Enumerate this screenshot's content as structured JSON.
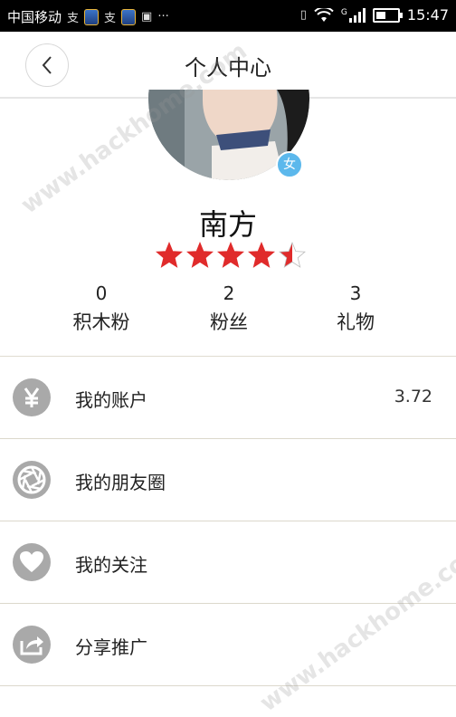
{
  "status_bar": {
    "carrier": "中国移动",
    "signal_label": "G",
    "time": "15:47",
    "battery_level": 0.45
  },
  "header": {
    "title": "个人中心"
  },
  "profile": {
    "gender_badge": "女",
    "name": "南方",
    "rating": 4.5,
    "rating_max": 5,
    "stats": [
      {
        "value": "0",
        "label": "积木粉"
      },
      {
        "value": "2",
        "label": "粉丝"
      },
      {
        "value": "3",
        "label": "礼物"
      }
    ]
  },
  "menu": {
    "items": [
      {
        "label": "我的账户",
        "value": "3.72",
        "icon": "yen-icon"
      },
      {
        "label": "我的朋友圈",
        "value": "",
        "icon": "aperture-icon"
      },
      {
        "label": "我的关注",
        "value": "",
        "icon": "heart-icon"
      },
      {
        "label": "分享推广",
        "value": "",
        "icon": "share-icon"
      }
    ]
  },
  "watermark": {
    "text": "www.hackhome.com"
  },
  "colors": {
    "star": "#e02b2b",
    "icon_gray": "#a9a9a9",
    "badge": "#5cb8ec"
  }
}
